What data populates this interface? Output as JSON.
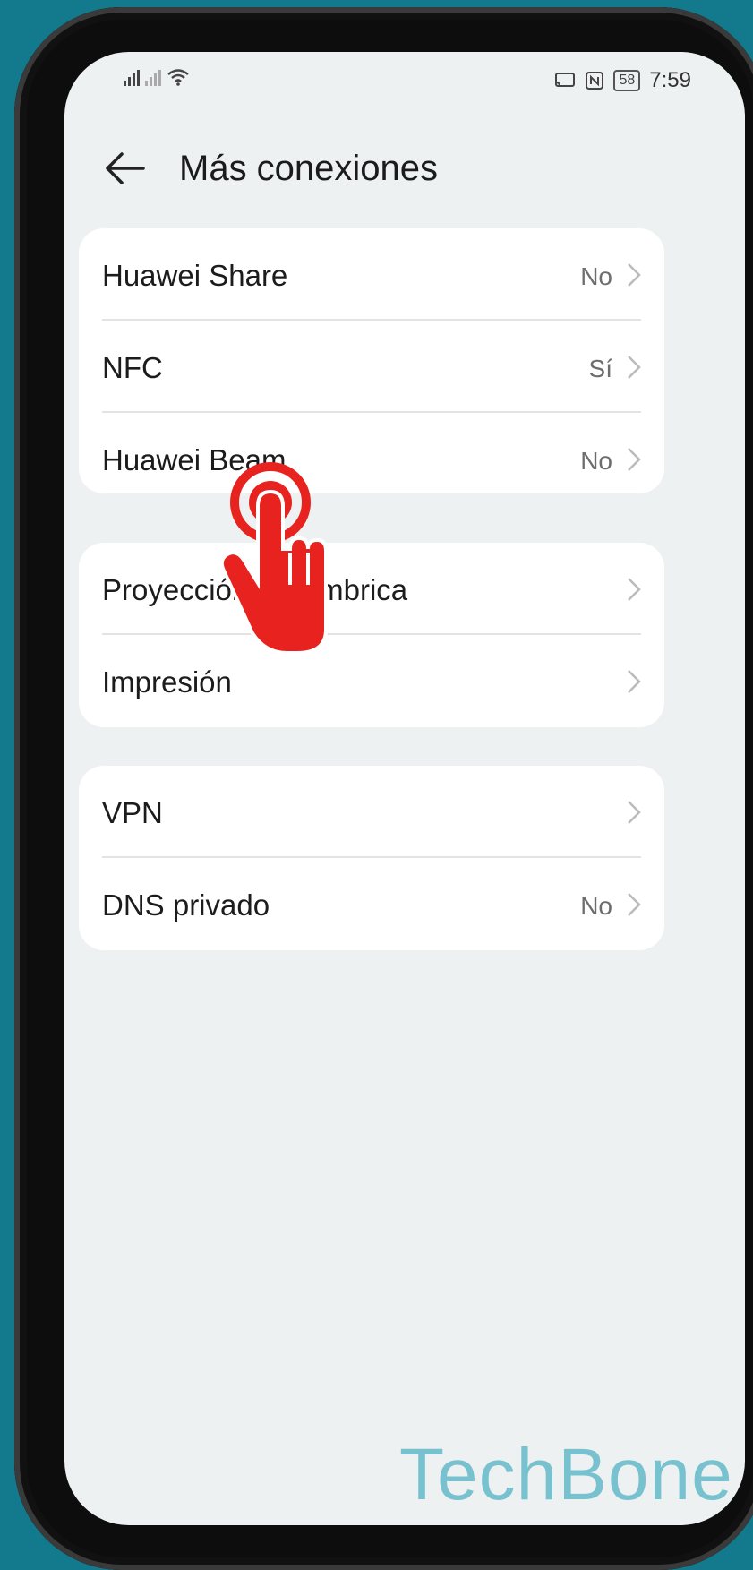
{
  "status_bar": {
    "time": "7:59",
    "battery": "58",
    "icons": [
      "signal-icon",
      "signal-no-sim-icon",
      "wifi-icon",
      "cast-icon",
      "nfc-icon",
      "battery-icon"
    ]
  },
  "header": {
    "title": "Más conexiones",
    "back_icon": "arrow-left-icon"
  },
  "groups": [
    {
      "items": [
        {
          "label": "Huawei Share",
          "value": "No"
        },
        {
          "label": "NFC",
          "value": "Sí"
        },
        {
          "label": "Huawei Beam",
          "value": "No"
        }
      ]
    },
    {
      "items": [
        {
          "label": "Proyección inalámbrica",
          "value": ""
        },
        {
          "label": "Impresión",
          "value": ""
        }
      ]
    },
    {
      "items": [
        {
          "label": "VPN",
          "value": ""
        },
        {
          "label": "DNS privado",
          "value": "No"
        }
      ]
    }
  ],
  "overlay": {
    "icon": "tap-hand-icon",
    "color": "#e8221e"
  },
  "watermark": "TechBone"
}
